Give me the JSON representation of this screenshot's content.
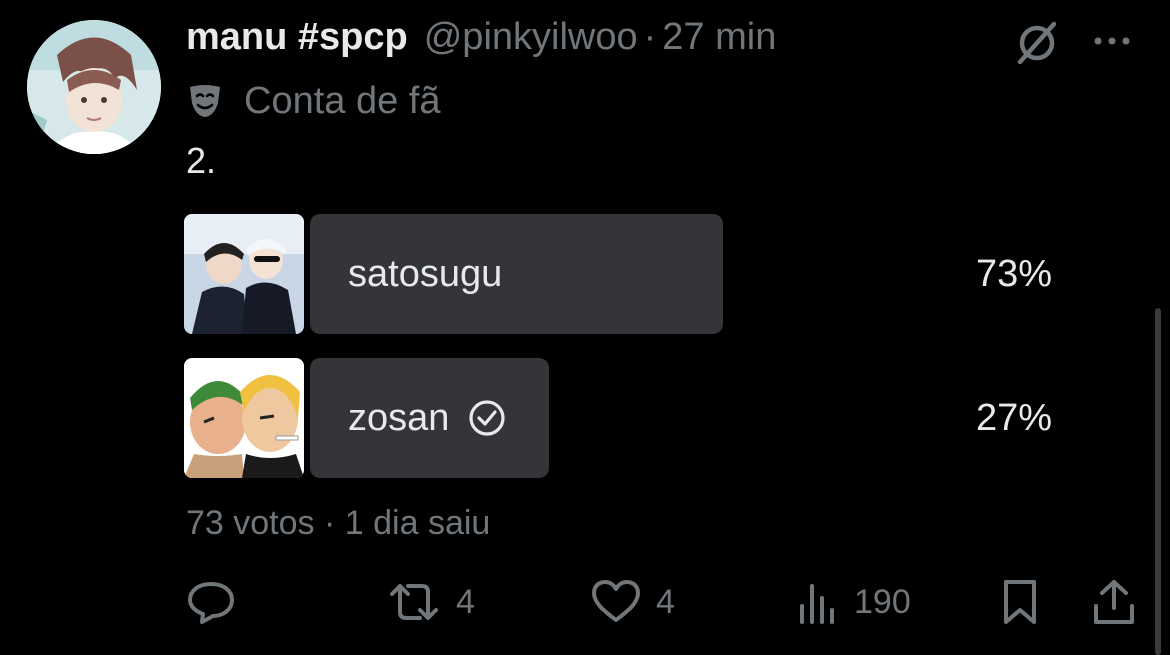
{
  "tweet": {
    "display_name": "manu #spcp",
    "handle": "@pinkyilwoo",
    "separator": "·",
    "time": "27 min",
    "label": "Conta de fã",
    "text": "2."
  },
  "poll": {
    "options": [
      {
        "label": "satosugu",
        "percent": "73%",
        "share": 0.73,
        "selected": false
      },
      {
        "label": "zosan",
        "percent": "27%",
        "share": 0.27,
        "selected": true
      }
    ],
    "votes": "73 votos",
    "separator": "·",
    "status": "1 dia saiu"
  },
  "actions": {
    "reply_count": "",
    "repost_count": "4",
    "like_count": "4",
    "views_count": "190"
  },
  "icons": {
    "more": "more-icon",
    "grok": "grok-icon",
    "mask": "theater-mask-icon",
    "reply": "reply-icon",
    "repost": "repost-icon",
    "like": "heart-icon",
    "views": "views-icon",
    "bookmark": "bookmark-icon",
    "share": "share-icon",
    "check": "check-circle-icon"
  },
  "colors": {
    "background": "#000000",
    "text": "#e7e9ea",
    "muted": "#71767b",
    "poll_bar": "#333538"
  }
}
